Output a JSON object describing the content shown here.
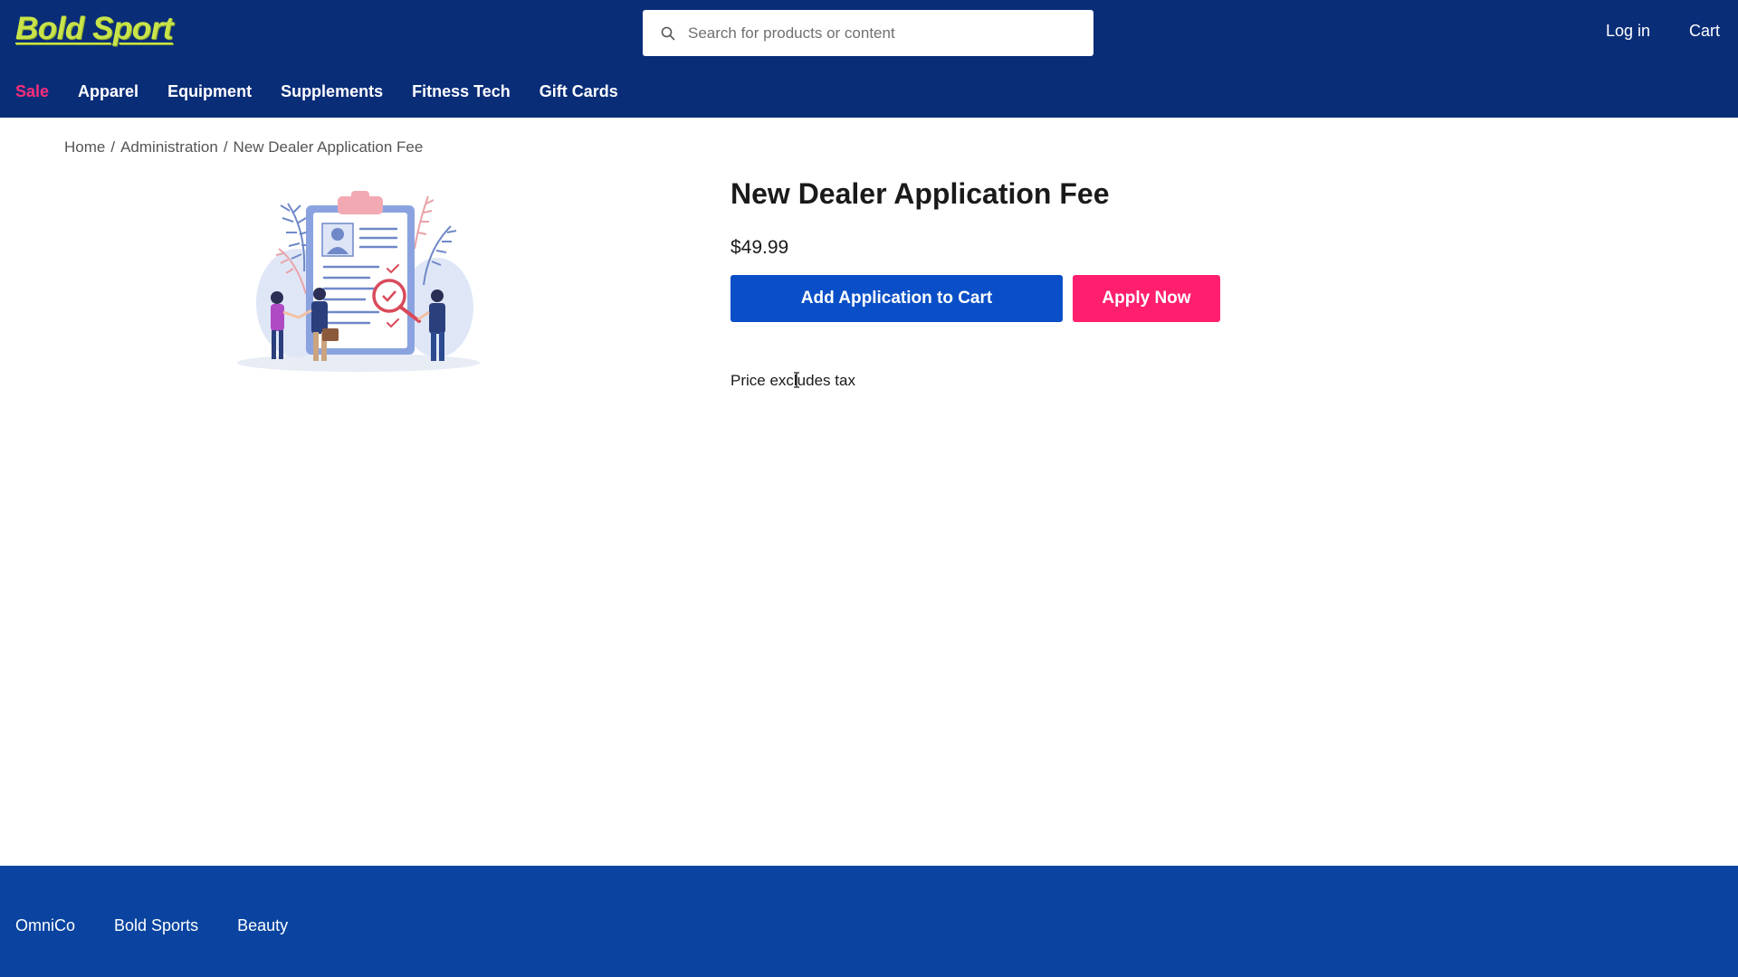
{
  "brand": {
    "logo_text": "Bold Sport"
  },
  "search": {
    "placeholder": "Search for products or content",
    "icon": "search-icon"
  },
  "header_links": {
    "login": "Log in",
    "cart": "Cart"
  },
  "nav": {
    "items": [
      {
        "label": "Sale"
      },
      {
        "label": "Apparel"
      },
      {
        "label": "Equipment"
      },
      {
        "label": "Supplements"
      },
      {
        "label": "Fitness Tech"
      },
      {
        "label": "Gift Cards"
      }
    ]
  },
  "breadcrumb": {
    "home": "Home",
    "sep": "/",
    "category": "Administration",
    "current": "New Dealer Application Fee"
  },
  "product": {
    "title": "New Dealer Application Fee",
    "price": "$49.99",
    "add_to_cart_label": "Add Application to Cart",
    "apply_label": "Apply Now",
    "tax_note": "Price excludes tax"
  },
  "footer": {
    "links": [
      {
        "label": "OmniCo"
      },
      {
        "label": "Bold Sports"
      },
      {
        "label": "Beauty"
      }
    ]
  },
  "colors": {
    "header_bg": "#0a2d78",
    "footer_bg": "#0a44a0",
    "primary_button": "#0a4fc7",
    "accent_button": "#ff1f6e",
    "sale_text": "#ff2d7a",
    "logo": "#c8e44a"
  }
}
